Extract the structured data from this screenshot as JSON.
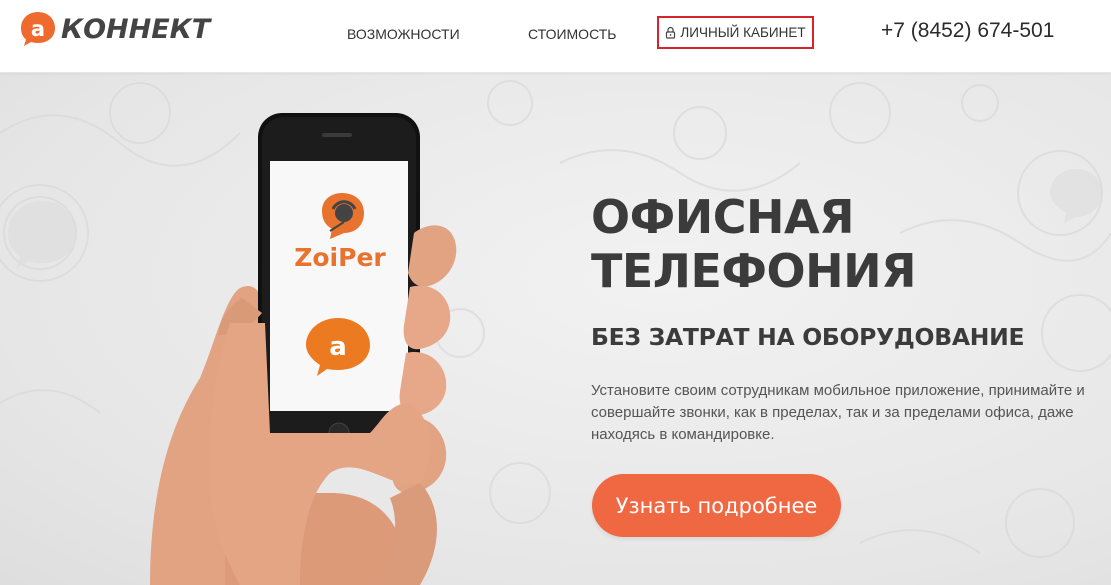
{
  "header": {
    "logo_text": "КОННЕКТ",
    "nav": {
      "features": "ВОЗМОЖНОСТИ",
      "price": "СТОИМОСТЬ",
      "cabinet": "ЛИЧНЫЙ КАБИНЕТ"
    },
    "phone": "+7 (8452) 674-501"
  },
  "hero": {
    "title": "ОФИСНАЯ ТЕЛЕФОНИЯ",
    "subtitle": "БЕЗ ЗАТРАТ НА ОБОРУДОВАНИЕ",
    "description": "Установите своим сотрудникам мобильное приложение, принимайте и совершайте звонки, как в пределах, так и за пределами офиса, даже находясь в командировке.",
    "cta": "Узнать подробнее",
    "phone_screen": {
      "app_name": "ZoiPer"
    }
  },
  "colors": {
    "accent": "#f06842",
    "brand_orange": "#e8732e",
    "highlight_border": "#d8232a",
    "text_dark": "#3b3b3b"
  },
  "icons": {
    "lock": "lock-icon",
    "logo": "speech-bubble-a-logo",
    "zoiper": "zoiper-headset-icon"
  }
}
